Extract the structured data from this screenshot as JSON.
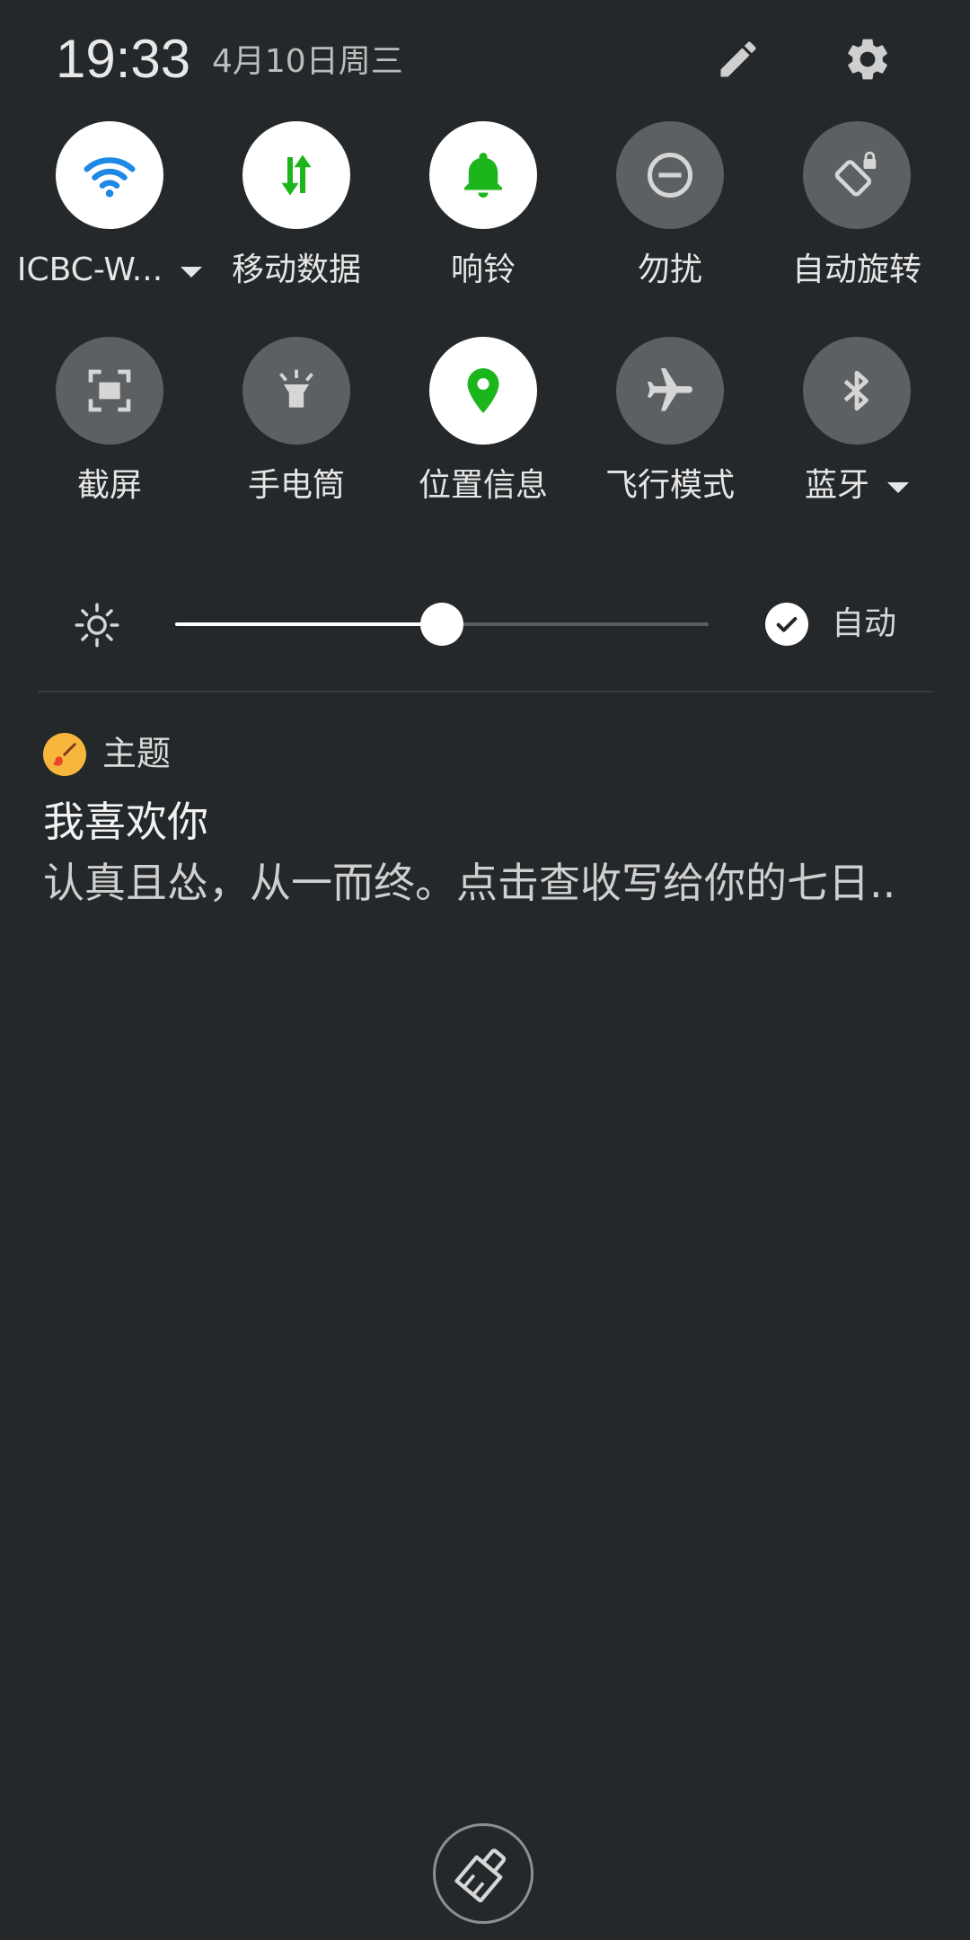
{
  "header": {
    "time": "19:33",
    "date": "4月10日周三",
    "edit_icon": "pencil-icon",
    "settings_icon": "gear-icon"
  },
  "tiles": [
    {
      "id": "wifi",
      "label": "ICBC-W...",
      "state": "on",
      "icon": "wifi-icon",
      "icon_color": "#1e88e5",
      "has_dropdown": true
    },
    {
      "id": "mobile-data",
      "label": "移动数据",
      "state": "on",
      "icon": "mobile-data-icon",
      "icon_color": "#1cb51c",
      "has_dropdown": false
    },
    {
      "id": "ring",
      "label": "响铃",
      "state": "on",
      "icon": "bell-icon",
      "icon_color": "#1cb51c",
      "has_dropdown": false
    },
    {
      "id": "dnd",
      "label": "勿扰",
      "state": "off",
      "icon": "do-not-disturb-icon",
      "icon_color": "#d0d0d0",
      "has_dropdown": false
    },
    {
      "id": "auto-rotate",
      "label": "自动旋转",
      "state": "off",
      "icon": "rotation-lock-icon",
      "icon_color": "#d0d0d0",
      "has_dropdown": false
    },
    {
      "id": "screenshot",
      "label": "截屏",
      "state": "off",
      "icon": "screenshot-icon",
      "icon_color": "#d0d0d0",
      "has_dropdown": false
    },
    {
      "id": "flashlight",
      "label": "手电筒",
      "state": "off",
      "icon": "flashlight-icon",
      "icon_color": "#d0d0d0",
      "has_dropdown": false
    },
    {
      "id": "location",
      "label": "位置信息",
      "state": "on",
      "icon": "location-pin-icon",
      "icon_color": "#1cb51c",
      "has_dropdown": false
    },
    {
      "id": "airplane",
      "label": "飞行模式",
      "state": "off",
      "icon": "airplane-icon",
      "icon_color": "#d0d0d0",
      "has_dropdown": false
    },
    {
      "id": "bluetooth",
      "label": "蓝牙",
      "state": "off",
      "icon": "bluetooth-icon",
      "icon_color": "#d0d0d0",
      "has_dropdown": true
    }
  ],
  "brightness": {
    "level": 0.5,
    "auto_label": "自动",
    "auto_checked": true
  },
  "notification": {
    "app_name": "主题",
    "app_icon": "paintbrush-icon",
    "title": "我喜欢你",
    "body": "认真且怂，从一而终。点击查收写给你的七日.."
  },
  "clear_all": {
    "icon": "broom-icon"
  },
  "colors": {
    "background": "#24282a",
    "tile_on": "#ffffff",
    "tile_off": "#5d6062",
    "accent_green": "#1cb51c",
    "accent_blue": "#1e88e5"
  }
}
